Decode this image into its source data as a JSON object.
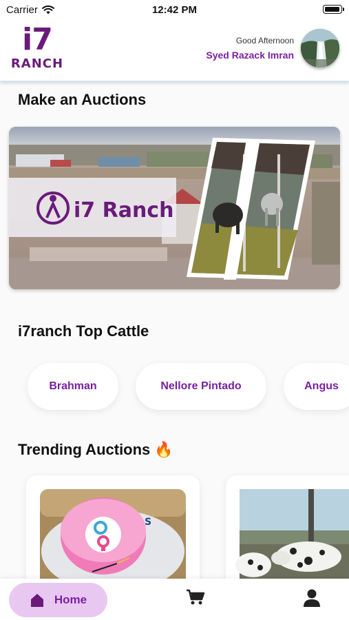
{
  "status_bar": {
    "carrier": "Carrier",
    "time": "12:42 PM"
  },
  "header": {
    "logo_top": "i7",
    "logo_bottom": "RANCH",
    "greeting": "Good Afternoon",
    "user_name": "Syed Razack Imran"
  },
  "sections": {
    "auctions_title": "Make an Auctions",
    "top_cattle_title": "i7ranch Top Cattle",
    "trending_title": "Trending Auctions 🔥"
  },
  "banner": {
    "brand_text": "i7 Ranch"
  },
  "top_cattle": [
    "Brahman",
    "Nellore Pintado",
    "Angus"
  ],
  "nav": {
    "home_label": "Home",
    "icons": [
      "home-icon",
      "cart-icon",
      "profile-icon"
    ]
  },
  "colors": {
    "brand": "#7a1fa2",
    "home_pill": "#e8c8f0"
  }
}
